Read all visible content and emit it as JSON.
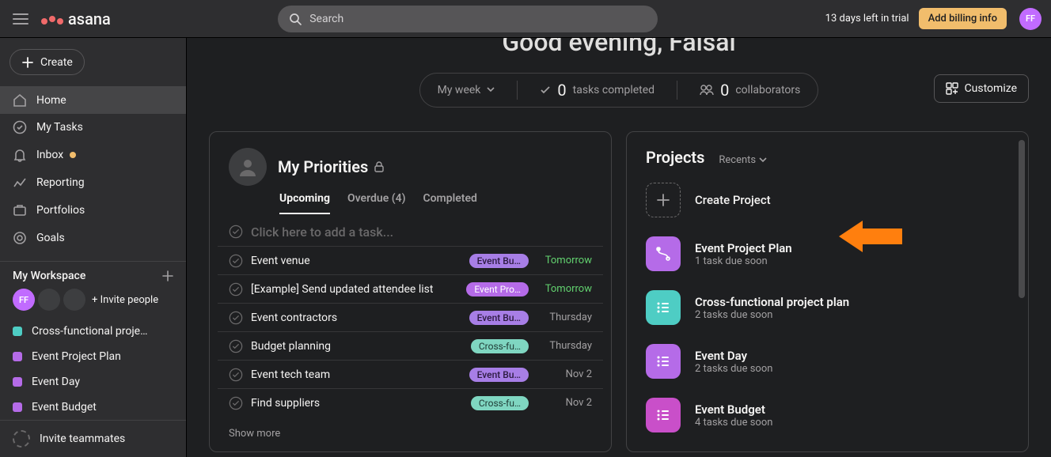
{
  "topbar": {
    "search_placeholder": "Search",
    "trial_note": "13 days left in trial",
    "billing_label": "Add billing info",
    "avatar_initials": "FF"
  },
  "sidebar": {
    "create_label": "Create",
    "nav": [
      {
        "key": "home",
        "label": "Home",
        "active": true
      },
      {
        "key": "my_tasks",
        "label": "My Tasks"
      },
      {
        "key": "inbox",
        "label": "Inbox",
        "notif": true
      },
      {
        "key": "reporting",
        "label": "Reporting"
      },
      {
        "key": "portfolios",
        "label": "Portfolios"
      },
      {
        "key": "goals",
        "label": "Goals"
      }
    ],
    "workspace_header": "My Workspace",
    "invite_label": "Invite people",
    "me_initials": "FF",
    "projects": [
      {
        "label": "Cross-functional proje…",
        "color": "#4ecdc4"
      },
      {
        "label": "Event Project Plan",
        "color": "#b56be8"
      },
      {
        "label": "Event Day",
        "color": "#b56be8"
      },
      {
        "label": "Event Budget",
        "color": "#b56be8"
      }
    ],
    "invite_teammates_label": "Invite teammates"
  },
  "home": {
    "greeting": "Good evening, Faisal",
    "summary": {
      "myweek_label": "My week",
      "tasks_completed_count": "0",
      "tasks_completed_label": "tasks completed",
      "collaborators_count": "0",
      "collaborators_label": "collaborators"
    },
    "customize_label": "Customize",
    "priorities": {
      "title": "My Priorities",
      "tabs": {
        "upcoming": "Upcoming",
        "overdue": "Overdue (4)",
        "completed": "Completed"
      },
      "placeholder": "Click here to add a task...",
      "tasks": [
        {
          "title": "Event venue",
          "pill": "Event Bu…",
          "pill_style": "purple",
          "due": "Tomorrow",
          "due_soon": true
        },
        {
          "title": "[Example] Send updated attendee list",
          "pill": "Event Pro…",
          "pill_style": "purple2",
          "due": "Tomorrow",
          "due_soon": true
        },
        {
          "title": "Event contractors",
          "pill": "Event Bu…",
          "pill_style": "purple",
          "due": "Thursday",
          "due_soon": false
        },
        {
          "title": "Budget planning",
          "pill": "Cross-fu…",
          "pill_style": "teal",
          "due": "Thursday",
          "due_soon": false
        },
        {
          "title": "Event tech team",
          "pill": "Event Bu…",
          "pill_style": "purple",
          "due": "Nov 2",
          "due_soon": false
        },
        {
          "title": "Find suppliers",
          "pill": "Cross-fu…",
          "pill_style": "teal",
          "due": "Nov 2",
          "due_soon": false
        }
      ],
      "show_more_label": "Show more"
    },
    "projects": {
      "title": "Projects",
      "recents_label": "Recents",
      "create_project_label": "Create Project",
      "items": [
        {
          "name": "Event Project Plan",
          "sub": "1 task due soon",
          "icon": "purple",
          "glyph": "flow"
        },
        {
          "name": "Cross-functional project plan",
          "sub": "2 tasks due soon",
          "icon": "teal",
          "glyph": "list"
        },
        {
          "name": "Event Day",
          "sub": "2 tasks due soon",
          "icon": "purple",
          "glyph": "list"
        },
        {
          "name": "Event Budget",
          "sub": "4 tasks due soon",
          "icon": "magenta",
          "glyph": "list"
        }
      ]
    }
  }
}
